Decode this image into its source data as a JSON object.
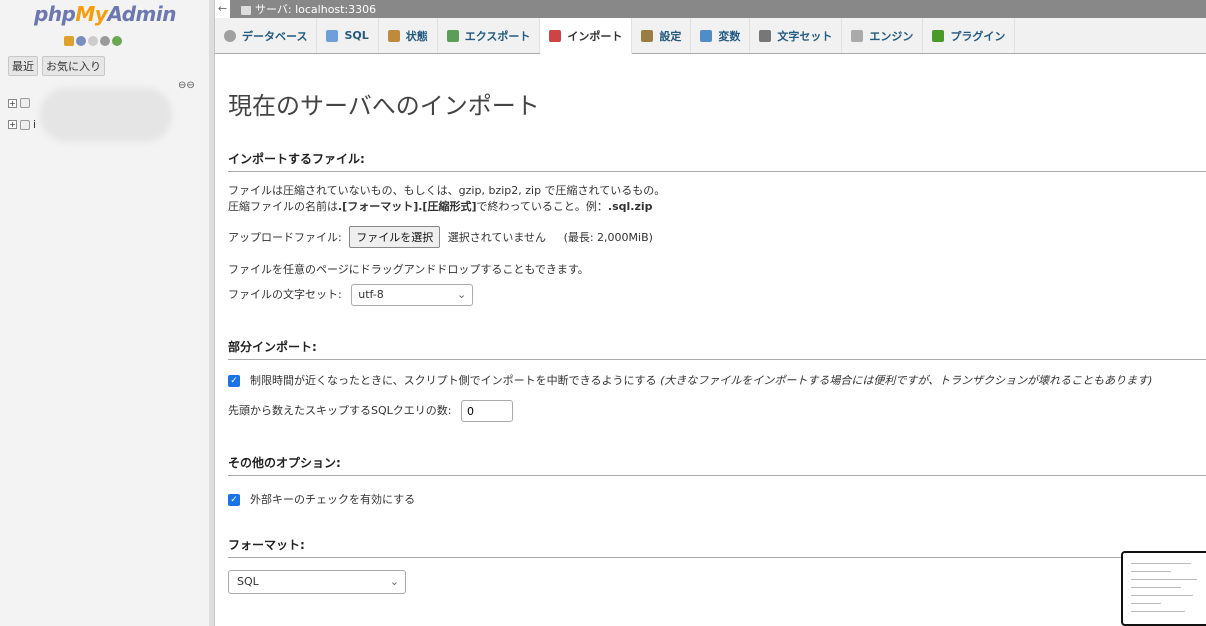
{
  "sidebar": {
    "logo": {
      "php": "php",
      "my": "My",
      "admin": "Admin"
    },
    "tabs": [
      "最近",
      "お気に入り"
    ],
    "tree": [
      {
        "label": ""
      },
      {
        "label": "i"
      }
    ]
  },
  "topbar": {
    "server": "サーバ: localhost:3306"
  },
  "menu": [
    {
      "label": "データベース",
      "color": "#a0a0a0"
    },
    {
      "label": "SQL",
      "color": "#6f9fd8"
    },
    {
      "label": "状態",
      "color": "#c08a3c"
    },
    {
      "label": "エクスポート",
      "color": "#5a9e5a"
    },
    {
      "label": "インポート",
      "color": "#c44"
    },
    {
      "label": "設定",
      "color": "#9a7d45"
    },
    {
      "label": "変数",
      "color": "#4e8dc7"
    },
    {
      "label": "文字セット",
      "color": "#777"
    },
    {
      "label": "エンジン",
      "color": "#aaa"
    },
    {
      "label": "プラグイン",
      "color": "#4a9a2a"
    }
  ],
  "main": {
    "title": "現在のサーバへのインポート",
    "file_section": {
      "heading": "インポートするファイル:",
      "desc1": "ファイルは圧縮されていないもの、もしくは、gzip, bzip2, zip で圧縮されているもの。",
      "desc2_prefix": "圧縮ファイルの名前は",
      "desc2_format": ".[フォーマット].[圧縮形式]",
      "desc2_mid": "で終わっていること。例：",
      "desc2_example": ".sql.zip",
      "upload_label": "アップロードファイル:",
      "choose_button": "ファイルを選択",
      "no_file": "選択されていません",
      "max_size": "(最長: 2,000MiB)",
      "dragdrop": "ファイルを任意のページにドラッグアンドドロップすることもできます。",
      "charset_label": "ファイルの文字セット:",
      "charset_value": "utf-8"
    },
    "partial_section": {
      "heading": "部分インポート:",
      "allow_interrupt": "制限時間が近くなったときに、スクリプト側でインポートを中断できるようにする",
      "allow_interrupt_note": "(大きなファイルをインポートする場合には便利ですが、トランザクションが壊れることもあります)",
      "skip_label": "先頭から数えたスキップするSQLクエリの数:",
      "skip_value": "0"
    },
    "other_section": {
      "heading": "その他のオプション:",
      "fk_checks": "外部キーのチェックを有効にする"
    },
    "format_section": {
      "heading": "フォーマット:",
      "format_value": "SQL"
    }
  }
}
